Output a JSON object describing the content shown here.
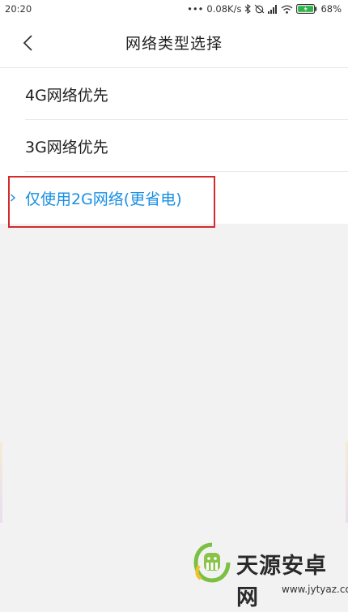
{
  "status_bar": {
    "time": "20:20",
    "dots": "•••",
    "speed": "0.08K/s",
    "battery": "68%"
  },
  "header": {
    "title": "网络类型选择"
  },
  "network_options": [
    {
      "label": "4G网络优先",
      "selected": false
    },
    {
      "label": "3G网络优先",
      "selected": false
    },
    {
      "label": "仅使用2G网络(更省电)",
      "selected": true
    }
  ],
  "watermark": {
    "title": "天源安卓网",
    "url": "www.jytyaz.com"
  },
  "colors": {
    "accent": "#1a8fe3",
    "highlight": "#d62a2a",
    "background": "#f2f2f2"
  }
}
